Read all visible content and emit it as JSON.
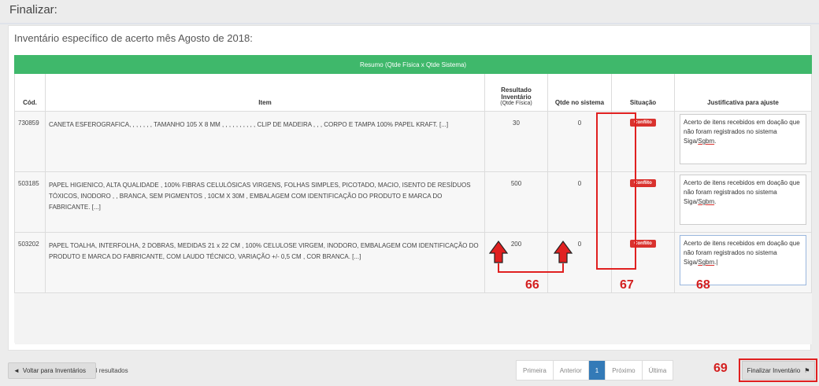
{
  "page_title": "Finalizar:",
  "subtitle": "Inventário específico de acerto mês Agosto de 2018:",
  "table": {
    "summary_header": "Resumo (Qtde Física x Qtde Sistema)",
    "columns": {
      "cod": "Cód.",
      "item": "Item",
      "resultado_line1": "Resultado",
      "resultado_line2": "Inventário",
      "resultado_sub": "(Qtde Física)",
      "qtde_sistema": "Qtde no sistema",
      "situacao": "Situação",
      "justificativa": "Justificativa para ajuste"
    },
    "rows": [
      {
        "cod": "730859",
        "item": "CANETA ESFEROGRAFICA, , , , , , , TAMANHO 105 X 8 MM , , , , , , , , , , CLIP DE MADEIRA , , , CORPO E TAMPA 100% PAPEL KRAFT. [...]",
        "resultado": "30",
        "sistema": "0",
        "situacao": "Conflito",
        "justificativa_a": "Acerto de itens recebidos em doação que não foram registrados no sistema Siga/",
        "justificativa_b": "Sgbm",
        "justificativa_c": "."
      },
      {
        "cod": "503185",
        "item": "PAPEL HIGIENICO, ALTA QUALIDADE , 100% FIBRAS CELULÓSICAS VIRGENS, FOLHAS SIMPLES, PICOTADO, MACIO, ISENTO DE RESÍDUOS TÓXICOS, INODORO , , BRANCA, SEM PIGMENTOS , 10CM X 30M , EMBALAGEM COM IDENTIFICAÇÃO DO PRODUTO E MARCA DO FABRICANTE. [...]",
        "resultado": "500",
        "sistema": "0",
        "situacao": "Conflito",
        "justificativa_a": "Acerto de itens recebidos em doação que não foram registrados no sistema Siga/",
        "justificativa_b": "Sgbm",
        "justificativa_c": "."
      },
      {
        "cod": "503202",
        "item": "PAPEL TOALHA, INTERFOLHA, 2 DOBRAS, MEDIDAS 21 x 22 CM , 100% CELULOSE VIRGEM, INODORO, EMBALAGEM COM IDENTIFICAÇÃO DO PRODUTO E MARCA DO FABRICANTE, COM LAUDO TÉCNICO, VARIAÇÃO +/- 0,5 CM , COR BRANCA. [...]",
        "resultado": "200",
        "sistema": "0",
        "situacao": "Conflito",
        "justificativa_a": "Acerto de itens recebidos em doação que não foram registrados no sistema Siga/",
        "justificativa_b": "Sgbm",
        "justificativa_c": ".|"
      }
    ]
  },
  "footer": {
    "showing": "Exibindo 1 a 3 de 3 resultados",
    "pagination": {
      "first": "Primeira",
      "prev": "Anterior",
      "current": "1",
      "next": "Próximo",
      "last": "Última"
    }
  },
  "buttons": {
    "back": "Voltar para Inventários",
    "finish": "Finalizar Inventário"
  },
  "annotations": {
    "a66": "66",
    "a67": "67",
    "a68": "68",
    "a69": "69"
  },
  "colors": {
    "header_green": "#3fb86b",
    "conflict_red": "#d9322e",
    "annotation_red": "#d42020",
    "active_page": "#337ab7"
  },
  "icons": {
    "back": "arrow-left-icon",
    "finish": "flag-icon",
    "annotation_arrow": "up-arrow-icon"
  }
}
